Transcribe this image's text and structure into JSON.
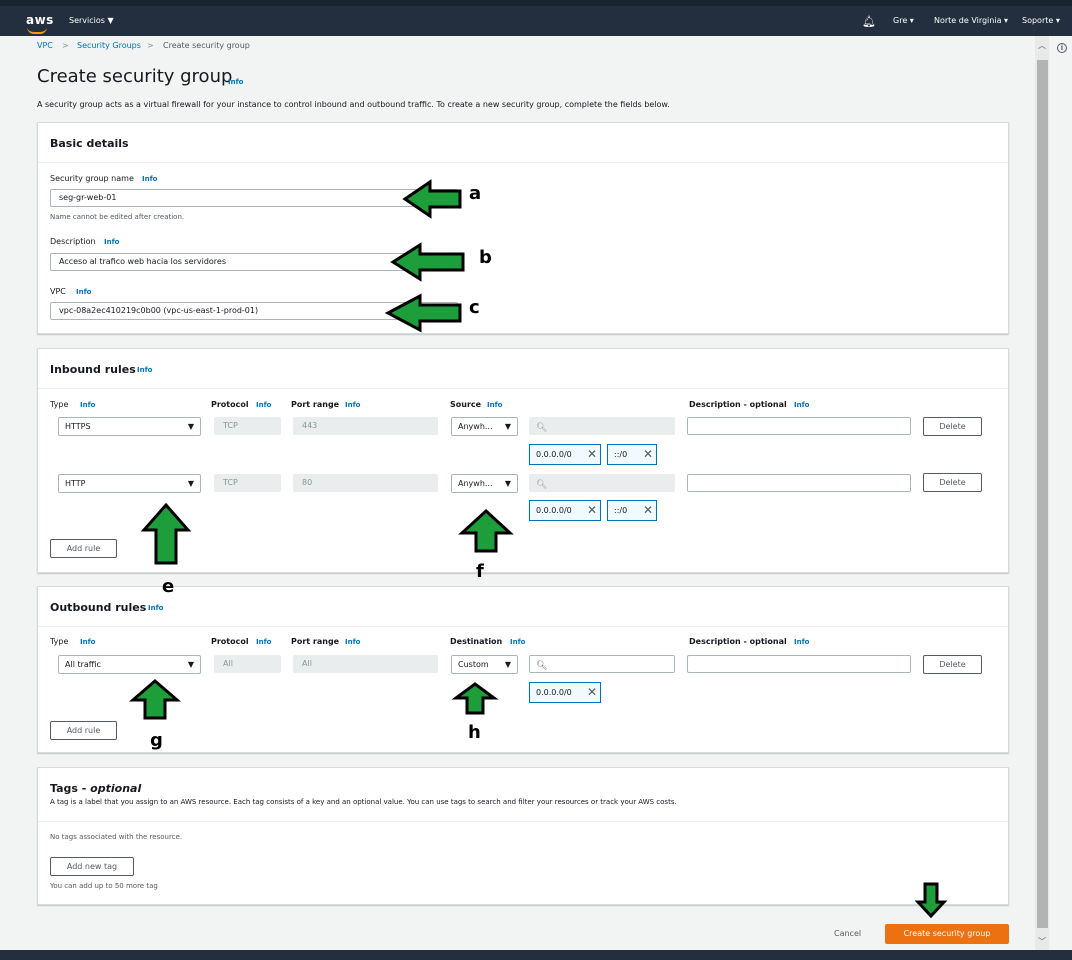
{
  "nav": {
    "services": "Servicios",
    "user": "Gre",
    "region": "Norte de Virginia",
    "support": "Soporte"
  },
  "breadcrumb": {
    "vpc": "VPC",
    "security_groups": "Security Groups",
    "current": "Create security group"
  },
  "page": {
    "title": "Create security group",
    "info": "Info",
    "description": "A security group acts as a virtual firewall for your instance to control inbound and outbound traffic. To create a new security group, complete the fields below."
  },
  "basic": {
    "title": "Basic details",
    "name_label": "Security group name",
    "name_value": "seg-gr-web-01",
    "name_hint": "Name cannot be edited after creation.",
    "desc_label": "Description",
    "desc_value": "Acceso al trafico web hacia los servidores",
    "vpc_label": "VPC",
    "vpc_value": "vpc-08a2ec410219c0b00 (vpc-us-east-1-prod-01)"
  },
  "inbound": {
    "title": "Inbound rules",
    "type_hdr": "Type",
    "protocol_hdr": "Protocol",
    "port_hdr": "Port range",
    "source_hdr": "Source",
    "desc_hdr": "Description - optional",
    "rows": [
      {
        "type": "HTTPS",
        "protocol": "TCP",
        "port": "443",
        "source": "Anywh...",
        "tokens": [
          "0.0.0.0/0",
          "::/0"
        ],
        "delete": "Delete"
      },
      {
        "type": "HTTP",
        "protocol": "TCP",
        "port": "80",
        "source": "Anywh...",
        "tokens": [
          "0.0.0.0/0",
          "::/0"
        ],
        "delete": "Delete"
      }
    ],
    "add_rule": "Add rule"
  },
  "outbound": {
    "title": "Outbound rules",
    "type_hdr": "Type",
    "protocol_hdr": "Protocol",
    "port_hdr": "Port range",
    "dest_hdr": "Destination",
    "desc_hdr": "Description - optional",
    "row": {
      "type": "All traffic",
      "protocol": "All",
      "port": "All",
      "dest": "Custom",
      "tokens": [
        "0.0.0.0/0"
      ],
      "delete": "Delete"
    },
    "add_rule": "Add rule"
  },
  "tags": {
    "title": "Tags",
    "title_suffix": "optional",
    "desc": "A tag is a label that you assign to an AWS resource. Each tag consists of a key and an optional value. You can use tags to search and filter your resources or track your AWS costs.",
    "empty": "No tags associated with the resource.",
    "add": "Add new tag",
    "hint": "You can add up to 50 more tag"
  },
  "footer": {
    "cancel": "Cancel",
    "create": "Create security group"
  },
  "annotations": {
    "a": "a",
    "b": "b",
    "c": "c",
    "e": "e",
    "f": "f",
    "g": "g",
    "h": "h"
  },
  "colors": {
    "nav_bg": "#232f3e",
    "link": "#0073bb",
    "primary": "#ec7211",
    "arrow_fill": "#1e9e3a"
  }
}
